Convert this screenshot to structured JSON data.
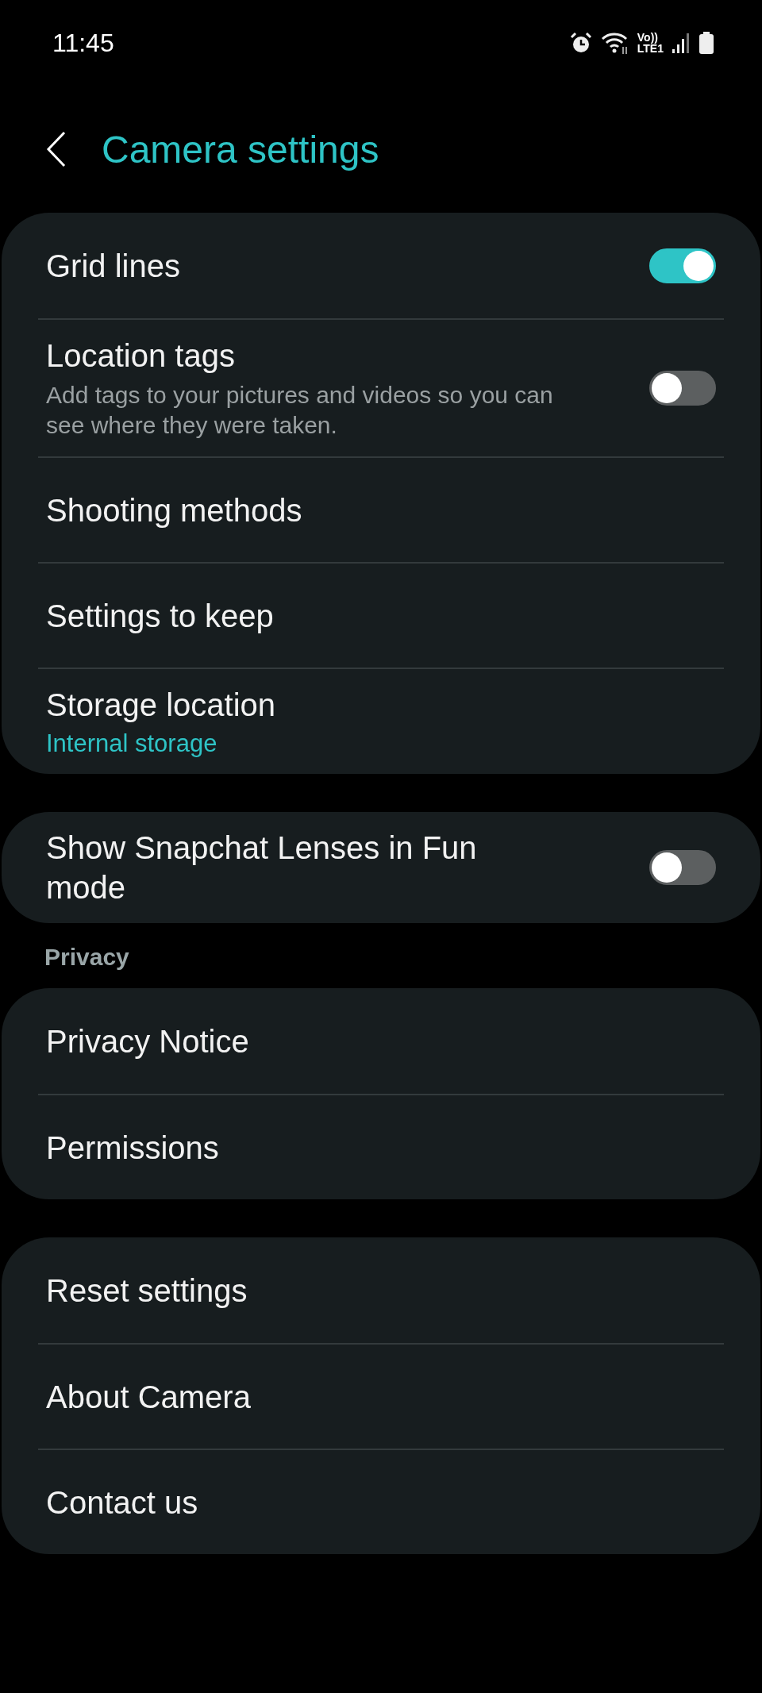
{
  "status_bar": {
    "time": "11:45",
    "network_label": [
      "Vo))",
      "LTE1"
    ]
  },
  "header": {
    "title": "Camera settings"
  },
  "sections": [
    {
      "items": [
        {
          "kind": "toggle",
          "title": "Grid lines",
          "on": true
        },
        {
          "kind": "toggle",
          "title": "Location tags",
          "subtitle": "Add tags to your pictures and videos so you can see where they were taken.",
          "on": false
        },
        {
          "kind": "link",
          "title": "Shooting methods"
        },
        {
          "kind": "link",
          "title": "Settings to keep"
        },
        {
          "kind": "value",
          "title": "Storage location",
          "value": "Internal storage"
        }
      ]
    },
    {
      "items": [
        {
          "kind": "toggle",
          "title": "Show Snapchat Lenses in Fun mode",
          "on": false
        }
      ]
    },
    {
      "heading": "Privacy",
      "items": [
        {
          "kind": "link",
          "title": "Privacy Notice"
        },
        {
          "kind": "link",
          "title": "Permissions"
        }
      ]
    },
    {
      "items": [
        {
          "kind": "link",
          "title": "Reset settings"
        },
        {
          "kind": "link",
          "title": "About Camera"
        },
        {
          "kind": "link",
          "title": "Contact us"
        }
      ]
    }
  ]
}
